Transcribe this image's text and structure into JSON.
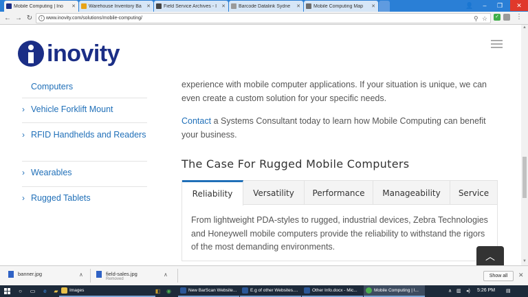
{
  "browser": {
    "tabs": [
      {
        "label": "Mobile Computing | Ino",
        "active": true,
        "icon_color": "#1b2e86"
      },
      {
        "label": "Warehouse Inventory Ba",
        "active": false,
        "icon_color": "#e8a317"
      },
      {
        "label": "Field Service Archives - I",
        "active": false,
        "icon_color": "#444444"
      },
      {
        "label": "Barcode Datalink Sydne",
        "active": false,
        "icon_color": "#9a9a9a"
      },
      {
        "label": "Mobile Computing Map",
        "active": false,
        "icon_color": "#6d6d6d"
      }
    ],
    "url": "www.inovity.com/solutions/mobile-computing/",
    "user_glyph": "👤",
    "min_glyph": "–",
    "restore_glyph": "❐",
    "close_glyph": "✕"
  },
  "site": {
    "logo_text": "inovity",
    "brand_color": "#1b2e86",
    "link_color": "#1f6fb8"
  },
  "sidebar": {
    "items": [
      {
        "label": "Computers",
        "chevron": false
      },
      {
        "label": "Vehicle Forklift Mount",
        "chevron": true
      },
      {
        "label": "RFID Handhelds and Readers",
        "chevron": true
      },
      {
        "label": "Wearables",
        "chevron": true
      },
      {
        "label": "Rugged Tablets",
        "chevron": true
      }
    ]
  },
  "content": {
    "intro_text": "experience with mobile computer applications. If your situation is unique, we can even create a custom solution for your specific needs.",
    "contact_link": "Contact",
    "contact_rest": " a Systems Consultant today to learn how Mobile Computing can benefit your business.",
    "section_title": "The Case For Rugged Mobile Computers",
    "tabs": [
      "Reliability",
      "Versatility",
      "Performance",
      "Manageability",
      "Service"
    ],
    "active_tab": "Reliability",
    "panel_text": "From lightweight PDA-styles to rugged, industrial devices, Zebra Technologies and Honeywell mobile computers provide the reliability to withstand the rigors of the most demanding environments."
  },
  "downloads": {
    "items": [
      {
        "name": "banner.jpg",
        "status": ""
      },
      {
        "name": "field-sales.jpg",
        "status": "Removed"
      }
    ],
    "show_all": "Show all"
  },
  "taskbar": {
    "apps": [
      {
        "label": "Images",
        "icon_color": "#e8c04a"
      },
      {
        "label": "New BarScan Website...",
        "icon_color": "#2b5797"
      },
      {
        "label": "E.g of other Websites....",
        "icon_color": "#2b5797"
      },
      {
        "label": "Other Info.docx - Mic...",
        "icon_color": "#2b5797"
      },
      {
        "label": "Mobile Computing | I...",
        "icon_color": "#4caf50"
      }
    ],
    "time": "5:26 PM"
  }
}
